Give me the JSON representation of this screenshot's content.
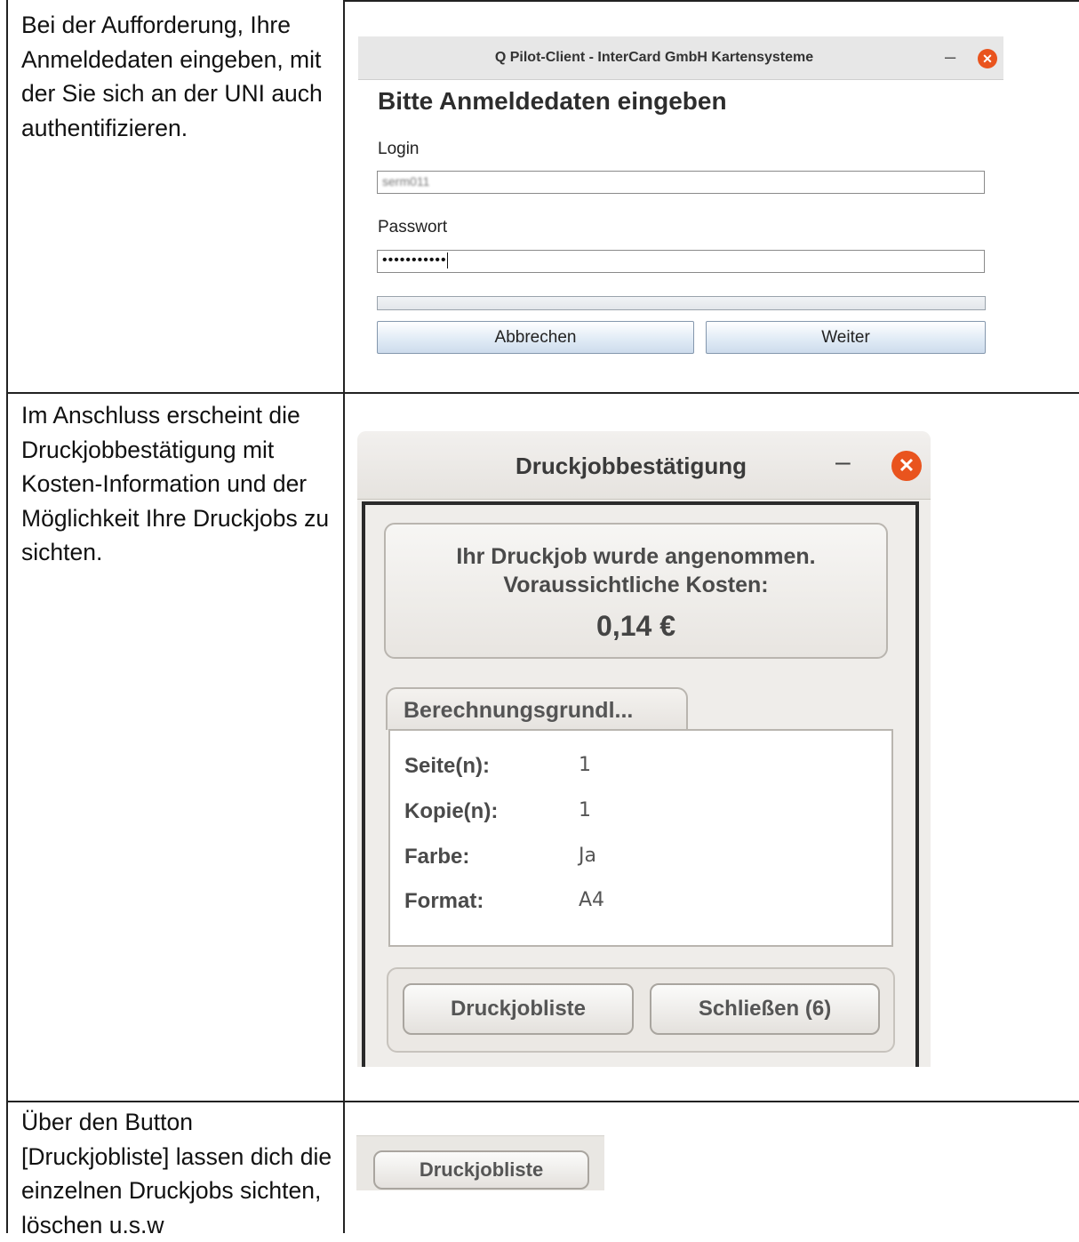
{
  "rows": [
    {
      "text": "Bei der Aufforderung, Ihre Anmeldedaten eingeben, mit der Sie sich an der UNI auch authentifizieren."
    },
    {
      "text": "Im Anschluss erscheint die Druckjobbestätigung mit Kosten-Information und der Möglichkeit Ihre Druckjobs zu sichten."
    },
    {
      "text": "Über den Button [Druckjobliste] lassen dich die einzelnen Druckjobs sichten, löschen u.s.w"
    }
  ],
  "login_window": {
    "title": "Q Pilot-Client - InterCard GmbH Kartensysteme",
    "minimize": "–",
    "close": "✕",
    "heading": "Bitte Anmeldedaten eingeben",
    "login_label": "Login",
    "login_value": "serm011",
    "password_label": "Passwort",
    "password_value": "•••••••••••",
    "cancel_label": "Abbrechen",
    "next_label": "Weiter"
  },
  "confirm_window": {
    "title": "Druckjobbestätigung",
    "minimize": "–",
    "close": "✕",
    "line1": "Ihr Druckjob wurde angenommen.",
    "line2": "Voraussichtliche Kosten:",
    "amount": "0,14 €",
    "tab_label": "Berechnungsgrundl...",
    "details": [
      {
        "key": "Seite(n):",
        "value": "1"
      },
      {
        "key": "Kopie(n):",
        "value": "1"
      },
      {
        "key": "Farbe:",
        "value": "Ja"
      },
      {
        "key": "Format:",
        "value": "A4"
      }
    ],
    "list_button": "Druckjobliste",
    "close_button": "Schließen (6)"
  },
  "snippet": {
    "button_label": "Druckjobliste"
  }
}
